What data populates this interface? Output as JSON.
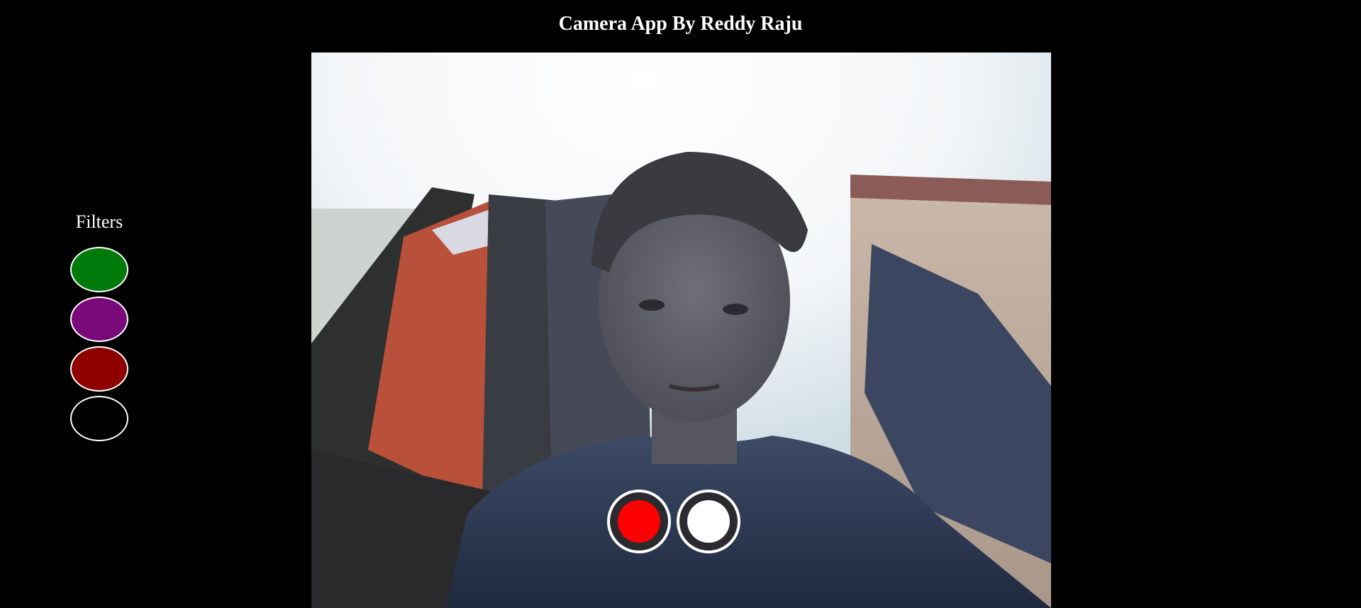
{
  "app": {
    "title": "Camera App By Reddy Raju"
  },
  "filters": {
    "heading": "Filters",
    "swatches": [
      {
        "name": "green",
        "color": "#007a0a"
      },
      {
        "name": "purple",
        "color": "#7a0a7a"
      },
      {
        "name": "red",
        "color": "#8f0000"
      },
      {
        "name": "none",
        "color": "#000000"
      }
    ]
  },
  "controls": {
    "record_color": "#ff0000",
    "capture_color": "#ffffff"
  }
}
